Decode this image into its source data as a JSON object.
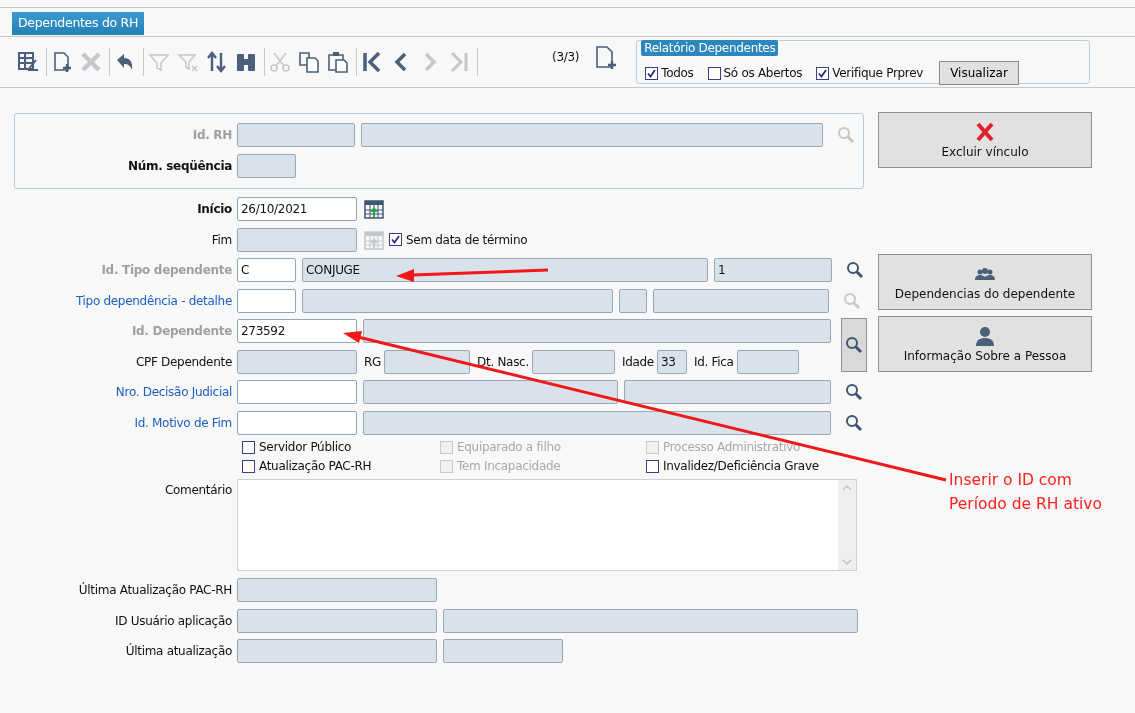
{
  "tab": {
    "label": "Dependentes do RH",
    "selected": true
  },
  "toolbar": {
    "groups": [
      [
        {
          "kind": "grid",
          "disabled": false
        }
      ],
      [
        {
          "kind": "new",
          "disabled": false
        },
        {
          "kind": "delete",
          "disabled": true
        }
      ],
      [
        {
          "kind": "undo",
          "disabled": false
        }
      ],
      [
        {
          "kind": "filter",
          "disabled": true
        },
        {
          "kind": "clear_filter",
          "disabled": true
        },
        {
          "kind": "sort",
          "disabled": false
        },
        {
          "kind": "find",
          "disabled": false
        }
      ],
      [
        {
          "kind": "cut",
          "disabled": true
        },
        {
          "kind": "copy",
          "disabled": false
        },
        {
          "kind": "paste",
          "disabled": false
        }
      ],
      [
        {
          "kind": "first",
          "disabled": false
        },
        {
          "kind": "prev",
          "disabled": false
        },
        {
          "kind": "next",
          "disabled": true
        },
        {
          "kind": "last",
          "disabled": true
        }
      ]
    ],
    "record_counter": "(3/3)"
  },
  "report_group": {
    "title": "Relatório Dependentes",
    "options": [
      {
        "label": "Todos",
        "checked": true
      },
      {
        "label": "Só os Abertos",
        "checked": false
      },
      {
        "label": "Verifique Prprev",
        "checked": true
      }
    ],
    "button": "Visualizar"
  },
  "form": {
    "id_rh": {
      "label": "Id. RH",
      "kind": "grey"
    },
    "num_sequencia": {
      "label": "Núm. seqüência",
      "kind": "bold"
    },
    "inicio": {
      "label": "Início",
      "kind": "bold",
      "value": "26/10/2021"
    },
    "fim": {
      "label": "Fim",
      "kind": "plain",
      "no_end_date": {
        "label": "Sem data de término",
        "checked": true
      }
    },
    "tipo_dependente": {
      "label": "Id. Tipo dependente",
      "kind": "grey",
      "code": "C",
      "name": "CONJUGE",
      "number": "1"
    },
    "tipo_detalhe": {
      "label": "Tipo dependência - detalhe",
      "kind": "link"
    },
    "dependente": {
      "label": "Id. Dependente",
      "kind": "grey",
      "value": "273592"
    },
    "cpf": {
      "label": "CPF Dependente",
      "kind": "plain",
      "rg_label": "RG",
      "birth_label": "Dt. Nasc.",
      "age_label": "Idade",
      "age": "33",
      "fica_label": "Id. Fica"
    },
    "decisao": {
      "label": "Nro. Decisão Judicial",
      "kind": "link"
    },
    "motivo": {
      "label": "Id. Motivo de Fim",
      "kind": "link"
    },
    "flags": [
      {
        "label": "Servidor Público",
        "checked": false,
        "disabled": false
      },
      {
        "label": "Equiparado a filho",
        "checked": false,
        "disabled": true
      },
      {
        "label": "Processo Administrativo",
        "checked": false,
        "disabled": true
      },
      {
        "label": "Atualização PAC-RH",
        "checked": false,
        "disabled": false
      },
      {
        "label": "Tem Incapacidade",
        "checked": false,
        "disabled": true
      },
      {
        "label": "Invalidez/Deficiência Grave",
        "checked": false,
        "disabled": false
      }
    ],
    "comentario": {
      "label": "Comentário",
      "kind": "plain"
    },
    "ultima_pac": {
      "label": "Última Atualização PAC-RH",
      "kind": "plain"
    },
    "usuario": {
      "label": "ID Usuário aplicação",
      "kind": "plain"
    },
    "ultima": {
      "label": "Última atualização",
      "kind": "plain"
    }
  },
  "side_buttons": [
    {
      "label": "Excluir vínculo",
      "kind": "delete"
    },
    {
      "label": "Dependencias do dependente",
      "kind": "group"
    },
    {
      "label": "Informação Sobre a Pessoa",
      "kind": "person"
    }
  ],
  "annotation": {
    "text": "Inserir o ID com Período de RH ativo"
  }
}
